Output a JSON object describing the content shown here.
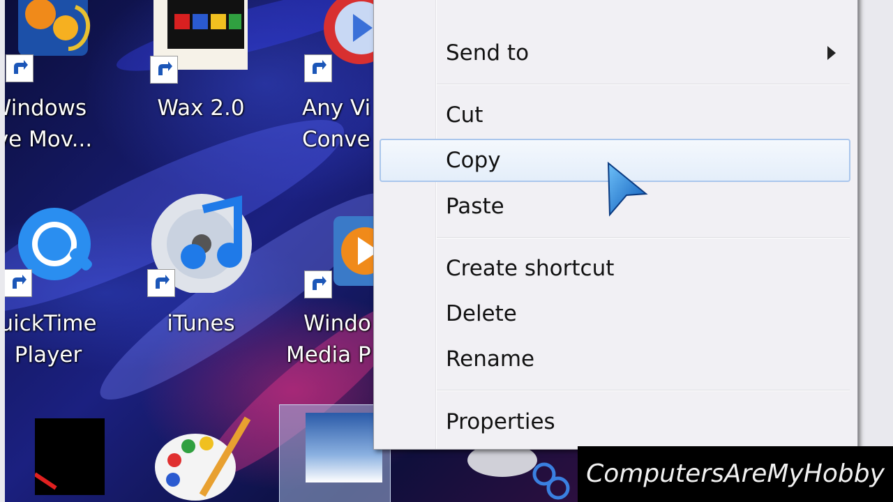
{
  "desktop": {
    "icons": [
      {
        "label_1": "Windows",
        "label_2": "ve Mov..."
      },
      {
        "label_1": "Wax 2.0"
      },
      {
        "label_1": "Any Vi",
        "label_2": "Conve"
      },
      {
        "label_1": "uickTime",
        "label_2": "Player"
      },
      {
        "label_1": "iTunes"
      },
      {
        "label_1": "Windo",
        "label_2": "Media P"
      }
    ]
  },
  "context_menu": {
    "items": [
      {
        "label": "Send to",
        "has_submenu": true
      },
      {
        "label": "Cut"
      },
      {
        "label": "Copy",
        "highlighted": true
      },
      {
        "label": "Paste"
      },
      {
        "label": "Create shortcut"
      },
      {
        "label": "Delete"
      },
      {
        "label": "Rename"
      },
      {
        "label": "Properties"
      }
    ]
  },
  "watermark": {
    "text": "ComputersAreMyHobby"
  },
  "colors": {
    "menu_bg": "#f1f0f4",
    "highlight_border": "#a9c6ec",
    "highlight_bg": "#e4eefa"
  }
}
